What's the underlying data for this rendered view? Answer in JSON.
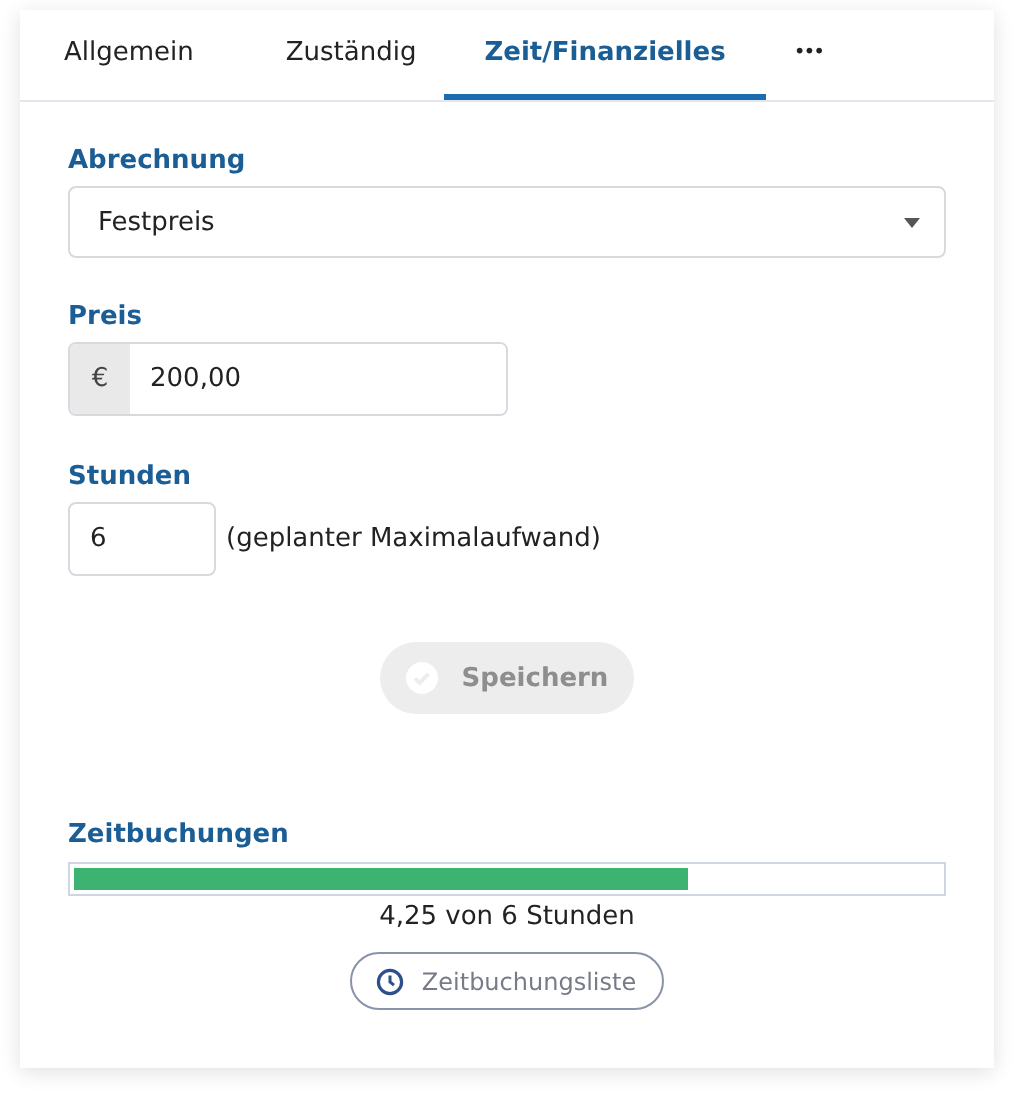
{
  "tabs": [
    {
      "label": "Allgemein",
      "selected": false
    },
    {
      "label": "Zuständig",
      "selected": false
    },
    {
      "label": "Zeit/Finanzielles",
      "selected": true
    },
    {
      "label": "•••",
      "selected": false
    }
  ],
  "billing": {
    "label": "Abrechnung",
    "value": "Festpreis"
  },
  "price": {
    "label": "Preis",
    "currency": "€",
    "value": "200,00"
  },
  "hours": {
    "label": "Stunden",
    "value": "6",
    "hint": "(geplanter Maximalaufwand)"
  },
  "save_button": {
    "label": "Speichern",
    "disabled": true
  },
  "time_bookings": {
    "label": "Zeitbuchungen",
    "level": 0.708,
    "reading": "4,25 von 6 Stunden",
    "list_button": "Zeitbuchungsliste"
  }
}
